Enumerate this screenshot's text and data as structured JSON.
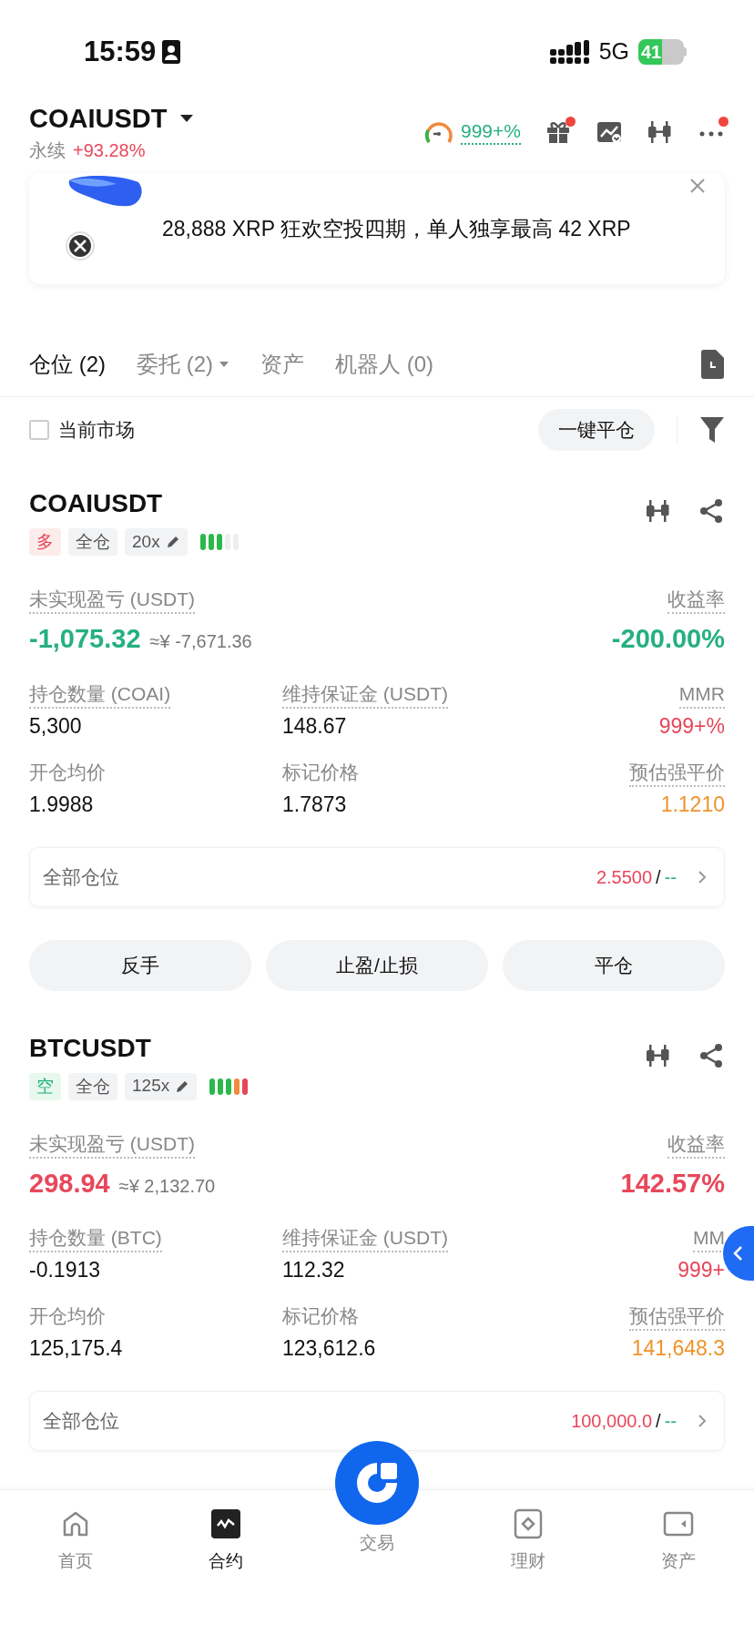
{
  "status_bar": {
    "time": "15:59",
    "network": "5G",
    "battery": "41"
  },
  "header": {
    "symbol": "COAIUSDT",
    "type": "永续",
    "change": "+93.28%",
    "ratio": "999+%",
    "icons": [
      {
        "kind": "gift",
        "badge": true
      },
      {
        "kind": "chart",
        "badge": false
      },
      {
        "kind": "candles",
        "badge": false
      },
      {
        "kind": "more",
        "badge": true
      }
    ]
  },
  "banner": {
    "text": "28,888 XRP 狂欢空投四期，单人独享最高 42 XRP"
  },
  "tabs": [
    {
      "label": "仓位 (2)",
      "selected": true,
      "dropdown": false
    },
    {
      "label": "委托 (2)",
      "selected": false,
      "dropdown": true
    },
    {
      "label": "资产",
      "selected": false,
      "dropdown": false
    },
    {
      "label": "机器人 (0)",
      "selected": false,
      "dropdown": false
    }
  ],
  "filter": {
    "label": "当前市场",
    "checked": false,
    "button": "一键平仓"
  },
  "positions": [
    {
      "symbol": "COAIUSDT",
      "side": "多",
      "long": true,
      "profit": false,
      "margin_mode": "全仓",
      "leverage": "20x",
      "risk_bars": [
        {
          "color": "#2bb84a"
        },
        {
          "color": "#2bb84a"
        },
        {
          "color": "#2bb84a"
        },
        {
          "color": "#eeeeee"
        },
        {
          "color": "#eeeeee"
        }
      ],
      "pnl_label": "未实现盈亏 (USDT)",
      "pnl": "-1,075.32",
      "pnl_cny": "≈¥ -7,671.36",
      "roe_label": "收益率",
      "roe": "-200.00%",
      "stats": [
        {
          "label": "持仓数量 (COAI)",
          "value": "5,300",
          "color": "#111111",
          "dotted": true
        },
        {
          "label": "维持保证金 (USDT)",
          "value": "148.67",
          "color": "#111111",
          "dotted": true
        },
        {
          "label": "MMR",
          "value": "999+%",
          "color": "#e8475a",
          "dotted": true
        },
        {
          "label": "开仓均价",
          "value": "1.9988",
          "color": "#111111",
          "dotted": false
        },
        {
          "label": "标记价格",
          "value": "1.7873",
          "color": "#111111",
          "dotted": false
        },
        {
          "label": "预估强平价",
          "value": "1.1210",
          "color": "#f0932b",
          "dotted": true
        }
      ],
      "all_positions": {
        "label": "全部仓位",
        "value": "2.5500",
        "separator": "/",
        "value2": "--"
      },
      "buttons": [
        "反手",
        "止盈/止损",
        "平仓"
      ]
    },
    {
      "symbol": "BTCUSDT",
      "side": "空",
      "long": false,
      "profit": true,
      "margin_mode": "全仓",
      "leverage": "125x",
      "risk_bars": [
        {
          "color": "#2bb84a"
        },
        {
          "color": "#2bb84a"
        },
        {
          "color": "#2bb84a"
        },
        {
          "color": "#f08a3c"
        },
        {
          "color": "#e8475a"
        }
      ],
      "pnl_label": "未实现盈亏 (USDT)",
      "pnl": "298.94",
      "pnl_cny": "≈¥ 2,132.70",
      "roe_label": "收益率",
      "roe": "142.57%",
      "stats": [
        {
          "label": "持仓数量 (BTC)",
          "value": "-0.1913",
          "color": "#111111",
          "dotted": true
        },
        {
          "label": "维持保证金 (USDT)",
          "value": "112.32",
          "color": "#111111",
          "dotted": true
        },
        {
          "label": "MM",
          "value": "999+",
          "color": "#e8475a",
          "dotted": true
        },
        {
          "label": "开仓均价",
          "value": "125,175.4",
          "color": "#111111",
          "dotted": false
        },
        {
          "label": "标记价格",
          "value": "123,612.6",
          "color": "#111111",
          "dotted": false
        },
        {
          "label": "预估强平价",
          "value": "141,648.3",
          "color": "#f0932b",
          "dotted": true
        }
      ],
      "all_positions": {
        "label": "全部仓位",
        "value": "100,000.0",
        "separator": "/",
        "value2": "--"
      }
    }
  ],
  "nav": [
    {
      "label": "首页",
      "kind": "home",
      "selected": false
    },
    {
      "label": "合约",
      "kind": "futures",
      "selected": true
    },
    {
      "label": "交易",
      "kind": "trade",
      "selected": false
    },
    {
      "label": "理财",
      "kind": "earn",
      "selected": false
    },
    {
      "label": "资产",
      "kind": "assets",
      "selected": false
    }
  ]
}
